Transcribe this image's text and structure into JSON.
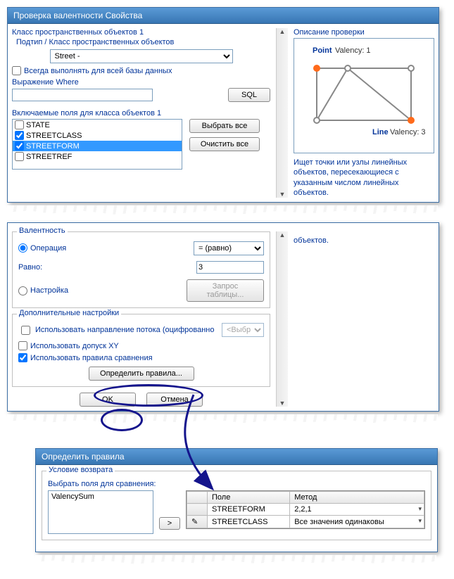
{
  "window1": {
    "title": "Проверка валентности Свойства",
    "class_label": "Класс пространственных объектов 1",
    "subtype_label": "Подтип / Класс пространственных объектов",
    "subtype_value": "Street -",
    "always_label": "Всегда выполнять для всей базы данных",
    "where_label": "Выражение Where",
    "sql_btn": "SQL",
    "included_label": "Включаемые поля для класса объектов 1",
    "fields": [
      {
        "name": "STATE",
        "checked": false,
        "selected": false
      },
      {
        "name": "STREETCLASS",
        "checked": true,
        "selected": false
      },
      {
        "name": "STREETFORM",
        "checked": true,
        "selected": true
      },
      {
        "name": "STREETREF",
        "checked": false,
        "selected": false
      }
    ],
    "select_all": "Выбрать все",
    "clear_all": "Очистить все",
    "desc_title": "Описание проверки",
    "point_label": "Point",
    "point_val": "Valency: 1",
    "line_label": "Line",
    "line_val": "Valency: 3",
    "desc_text": "Ищет точки или узлы линейных объектов, пересекающиеся с указанным числом линейных объектов."
  },
  "window2": {
    "valency_title": "Валентность",
    "operation_label": "Операция",
    "op_value": "= (равно)",
    "equal_label": "Равно:",
    "equal_value": "3",
    "setup_label": "Настройка",
    "table_query_btn": "Запрос таблицы...",
    "add_title": "Дополнительные настройки",
    "flow_label": "Использовать  направление  потока  (оцифрованно",
    "flow_select": "<Выбра",
    "xy_label": "Использовать допуск XY",
    "rules_label": "Использовать правила сравнения",
    "define_rules_btn": "Определить правила...",
    "ok_btn": "OK",
    "cancel_btn": "Отмена",
    "obj_stub": "объектов."
  },
  "window3": {
    "title": "Определить правила",
    "ret_label": "Условие возврата",
    "select_fields_label": "Выбрать поля для сравнения:",
    "list_val": "ValencySum",
    "move_btn": ">",
    "col_field": "Поле",
    "col_method": "Метод",
    "rows": [
      {
        "field": "STREETFORM",
        "method": "2,2,1"
      },
      {
        "field": "STREETCLASS",
        "method": "Все значения одинаковы"
      }
    ]
  }
}
